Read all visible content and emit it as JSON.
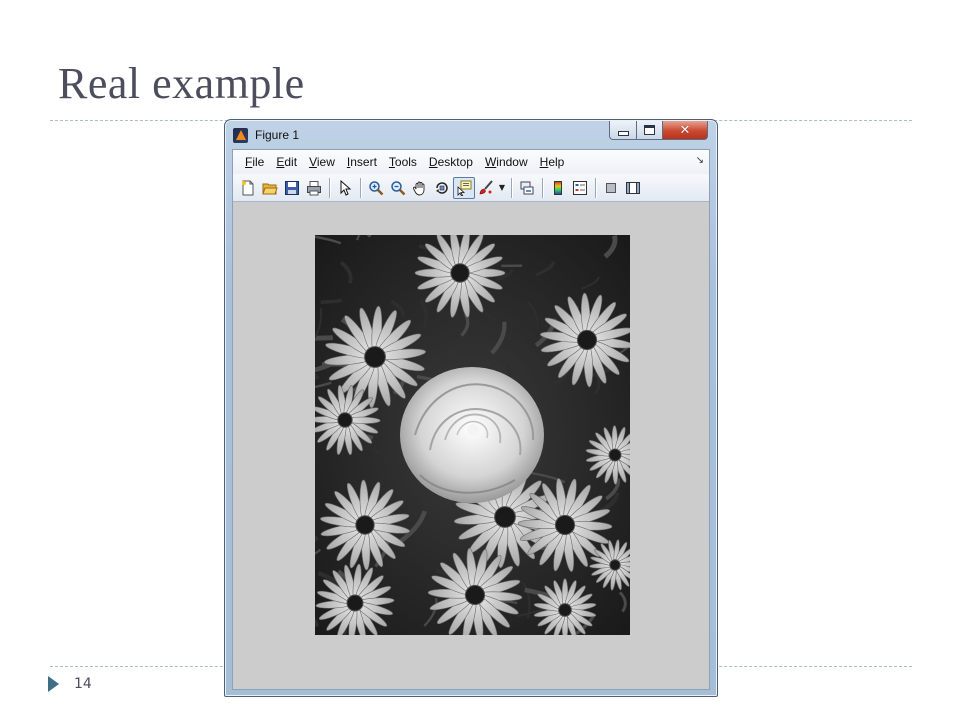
{
  "slide": {
    "title": "Real example",
    "page_number": "14"
  },
  "window": {
    "title": "Figure 1",
    "icon": "matlab-icon",
    "caption_buttons": [
      "minimize",
      "maximize",
      "close"
    ]
  },
  "menubar": {
    "items": [
      {
        "prefix": "",
        "accel": "F",
        "rest": "ile"
      },
      {
        "prefix": "",
        "accel": "E",
        "rest": "dit"
      },
      {
        "prefix": "",
        "accel": "V",
        "rest": "iew"
      },
      {
        "prefix": "",
        "accel": "I",
        "rest": "nsert"
      },
      {
        "prefix": "",
        "accel": "T",
        "rest": "ools"
      },
      {
        "prefix": "",
        "accel": "D",
        "rest": "esktop"
      },
      {
        "prefix": "",
        "accel": "W",
        "rest": "indow"
      },
      {
        "prefix": "",
        "accel": "H",
        "rest": "elp"
      }
    ],
    "overflow_glyph": "↘"
  },
  "toolbar": {
    "buttons": [
      "new-figure-icon",
      "open-file-icon",
      "save-icon",
      "print-icon",
      "edit-plot-arrow-icon",
      "zoom-in-icon",
      "zoom-out-icon",
      "pan-hand-icon",
      "rotate-3d-icon",
      "data-cursor-icon",
      "brush-icon",
      "link-plot-icon",
      "insert-colorbar-icon",
      "insert-legend-icon",
      "hide-plot-tools-icon",
      "show-plot-tools-icon"
    ]
  },
  "figure": {
    "image": "grayscale-flowers-photo"
  },
  "colors": {
    "title_text": "#4d4d5e",
    "rule": "#a9bdc9",
    "bullet": "#3e6e86",
    "figure_background": "#cccccc",
    "window_frame": "#a9c0da"
  }
}
